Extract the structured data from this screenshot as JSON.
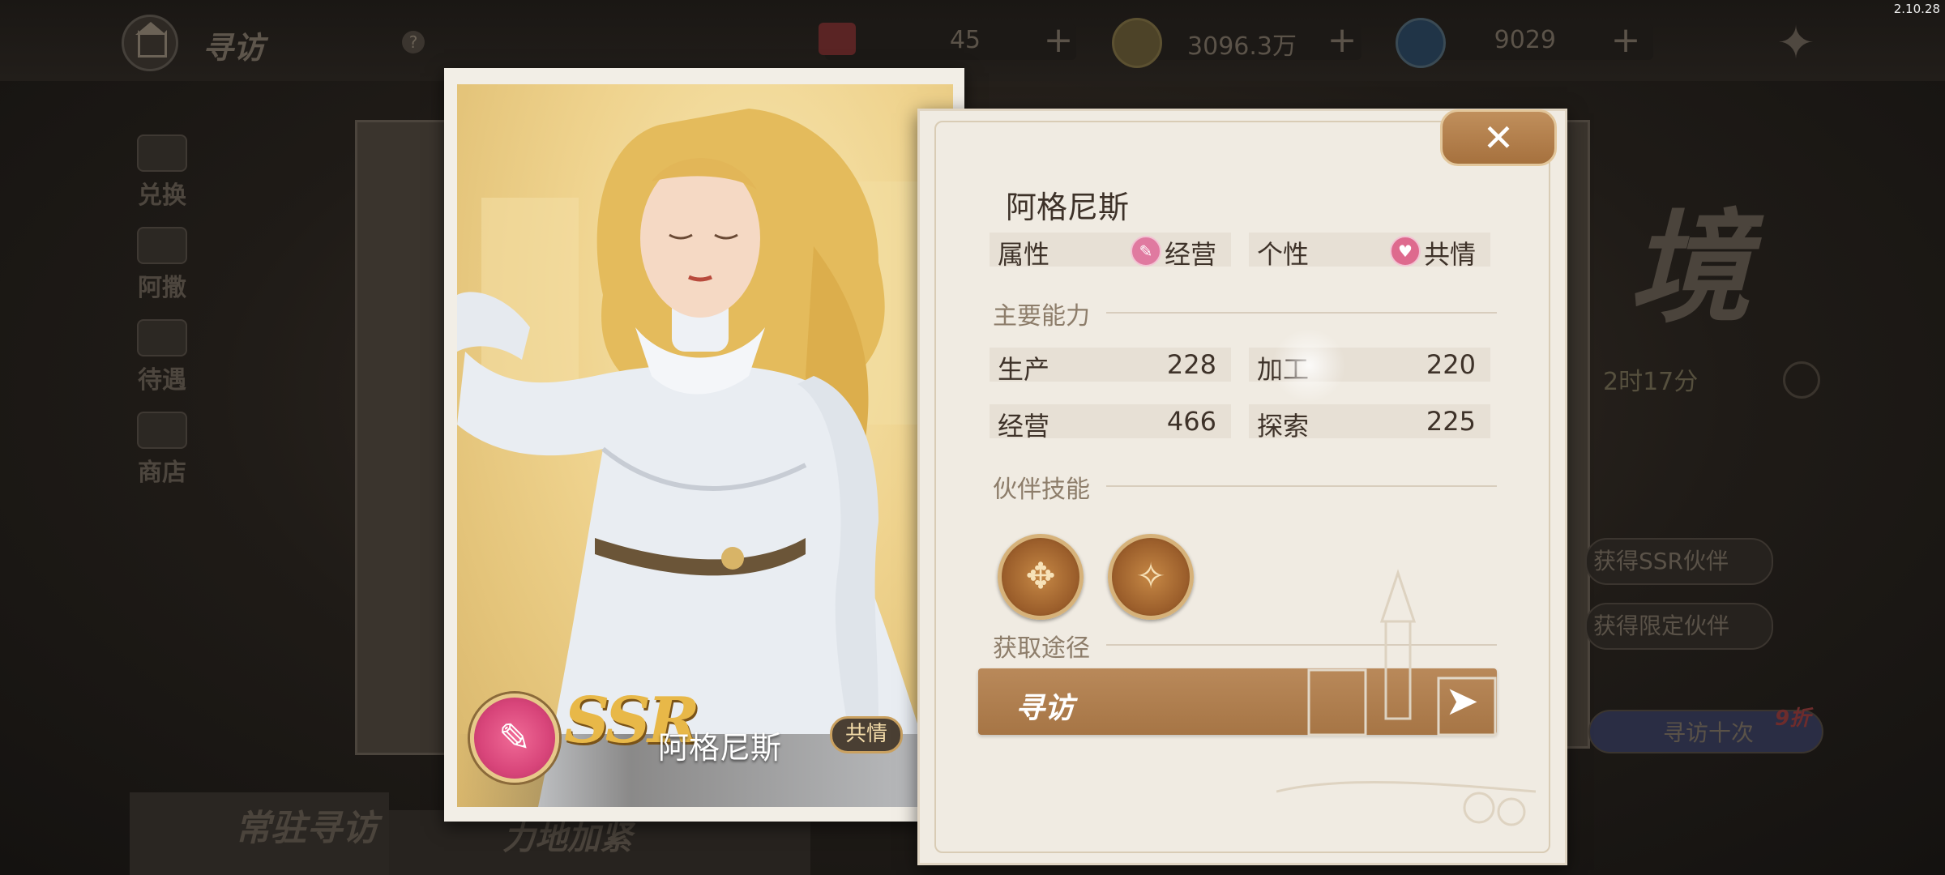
{
  "version": "2.10.28",
  "background": {
    "page_title": "寻访",
    "help_icon": "question-icon",
    "resources": [
      {
        "icon": "ticket-icon",
        "value": "45",
        "color": "#7a2424"
      },
      {
        "icon": "coin-icon",
        "value": "3096.3万",
        "color": "#6b5a2c"
      },
      {
        "icon": "gem-icon",
        "value": "9029",
        "color": "#23405a"
      }
    ],
    "side_menu": [
      {
        "label": "兑换",
        "icon": "exchange-icon"
      },
      {
        "label": "阿撒",
        "icon": "gift-icon"
      },
      {
        "label": "待遇",
        "icon": "card-icon"
      },
      {
        "label": "商店",
        "icon": "shop-icon"
      }
    ],
    "timer_text": "2时17分",
    "pill_1": "获得SSR伙伴",
    "pill_2": "获得限定伙伴",
    "ten_draw": "寻访十次",
    "discount": "9折",
    "banner_left": "常驻寻访",
    "banner_mid": "力地加紧"
  },
  "card": {
    "rarity": "SSR",
    "name": "阿格尼斯",
    "trait": "共情",
    "emblem_icon": "management-icon",
    "accent_color": "#e8b848"
  },
  "info": {
    "name": "阿格尼斯",
    "attr_label": "属性",
    "attr_value": "经营",
    "attr_icon": "management-icon",
    "personality_label": "个性",
    "personality_value": "共情",
    "personality_icon": "heart-icon",
    "abilities_title": "主要能力",
    "abilities": [
      {
        "label": "生产",
        "value": "228"
      },
      {
        "label": "加工",
        "value": "220"
      },
      {
        "label": "经营",
        "value": "466"
      },
      {
        "label": "探索",
        "value": "225"
      }
    ],
    "skills_title": "伙伴技能",
    "skills": [
      {
        "icon": "compass-skill-icon"
      },
      {
        "icon": "coins-skill-icon"
      }
    ],
    "source_title": "获取途径",
    "source_button": "寻访",
    "close_icon": "close-icon",
    "button_color": "#a67545"
  }
}
